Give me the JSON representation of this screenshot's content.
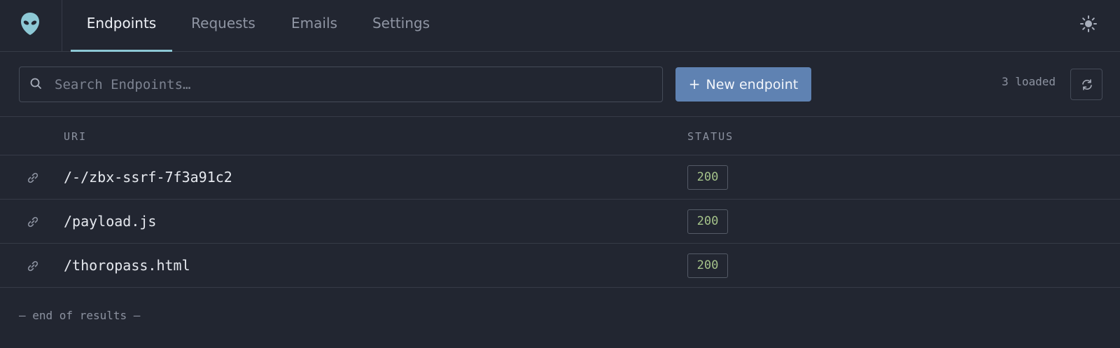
{
  "colors": {
    "background": "#222631",
    "accent": "#8dc8d5",
    "primary_button": "#5f82b2",
    "status_ok": "#a5c38a"
  },
  "nav": {
    "logo_icon": "alien-icon",
    "tabs": [
      {
        "label": "Endpoints",
        "active": true
      },
      {
        "label": "Requests",
        "active": false
      },
      {
        "label": "Emails",
        "active": false
      },
      {
        "label": "Settings",
        "active": false
      }
    ],
    "theme_icon": "sun-icon"
  },
  "toolbar": {
    "search_placeholder": "Search Endpoints…",
    "search_value": "",
    "new_button_label": "New endpoint",
    "new_button_icon": "plus-icon",
    "loaded_text": "3 loaded",
    "refresh_icon": "refresh-icon"
  },
  "table": {
    "columns": [
      "URI",
      "STATUS"
    ],
    "rows": [
      {
        "uri": "/-/zbx-ssrf-7f3a91c2",
        "status": "200"
      },
      {
        "uri": "/payload.js",
        "status": "200"
      },
      {
        "uri": "/thoropass.html",
        "status": "200"
      }
    ],
    "end_note": "— end of results —"
  }
}
